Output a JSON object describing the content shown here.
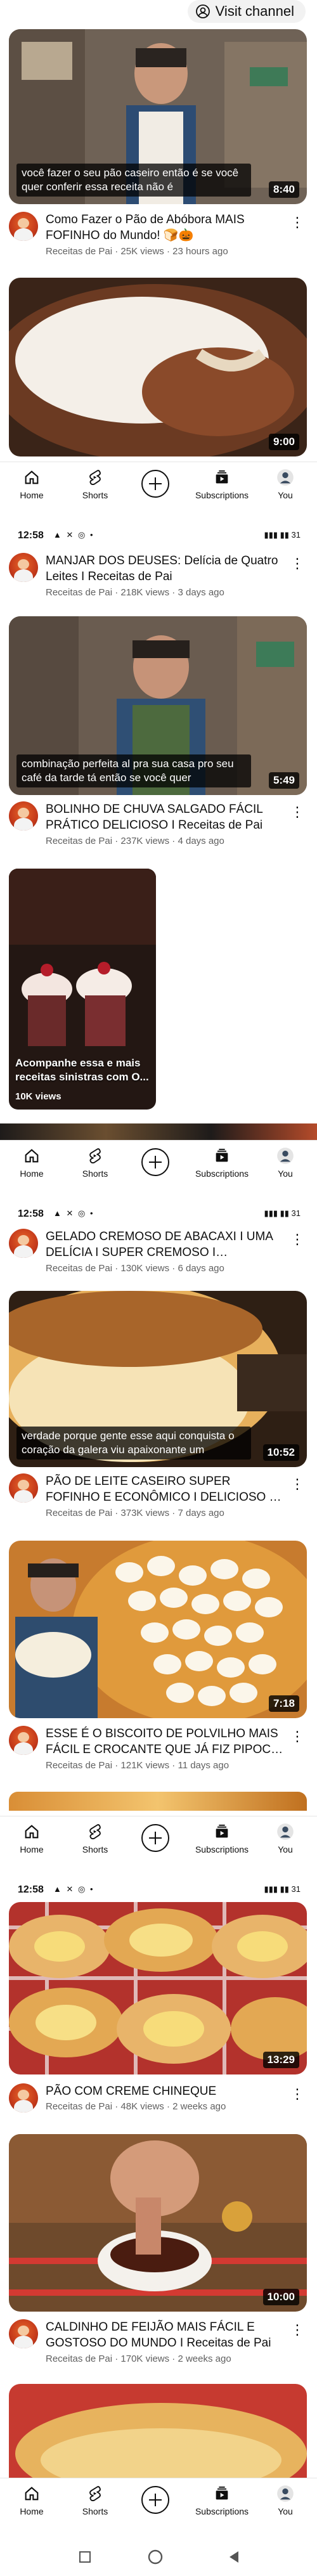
{
  "header": {
    "visit_channel_label": "Visit channel"
  },
  "status_bar": {
    "time": "12:58",
    "left_icons": "▲ ✕ ◎ •",
    "right_icons": "▮▮▮ ▮▮ 31"
  },
  "nav": {
    "home": "Home",
    "shorts": "Shorts",
    "subscriptions": "Subscriptions",
    "you": "You"
  },
  "videos": [
    {
      "caption": "você fazer o seu pão caseiro então é se você quer conferir essa receita não é",
      "duration": "8:40",
      "title": "Como Fazer o Pão de Abóbora MAIS FOFINHO do Mundo! 🍞🎃",
      "channel": "Receitas de Pai",
      "views": "25K views",
      "age": "23 hours ago"
    },
    {
      "caption": "",
      "duration": "9:00",
      "title": "MANJAR DOS DEUSES: Delícia de Quatro Leites I Receitas de Pai",
      "channel": "Receitas de Pai",
      "views": "218K views",
      "age": "3 days ago"
    },
    {
      "caption": "combinação perfeita al pra sua casa pro seu café da tarde tá então se você quer",
      "duration": "5:49",
      "title": "BOLINHO DE CHUVA SALGADO FÁCIL PRÁTICO DELICIOSO I Receitas de Pai",
      "channel": "Receitas de Pai",
      "views": "237K views",
      "age": "4 days ago"
    },
    {
      "caption": "",
      "duration": "",
      "title": "GELADO CREMOSO DE ABACAXI I UMA DELÍCIA I SUPER CREMOSO I SOBREMESA ...",
      "channel": "Receitas de Pai",
      "views": "130K views",
      "age": "6 days ago"
    },
    {
      "caption": "verdade porque gente esse aqui conquista o coração da galera viu apaixonante um",
      "duration": "10:52",
      "title": "PÃO DE LEITE CASEIRO SUPER FOFINHO E ECONÔMICO I DELICIOSO I FÁCIL I Receita...",
      "channel": "Receitas de Pai",
      "views": "373K views",
      "age": "7 days ago"
    },
    {
      "caption": "",
      "duration": "7:18",
      "title": "ESSE É O BISCOITO DE POLVILHO MAIS FÁCIL E CROCANTE QUE JÁ FIZ PIPOCA DE...",
      "channel": "Receitas de Pai",
      "views": "121K views",
      "age": "11 days ago"
    },
    {
      "caption": "",
      "duration": "13:29",
      "title": "PÃO COM CREME CHINEQUE",
      "channel": "Receitas de Pai",
      "views": "48K views",
      "age": "2 weeks ago"
    },
    {
      "caption": "",
      "duration": "10:00",
      "title": "CALDINHO DE FEIJÃO MAIS FÁCIL E GOSTOSO DO MUNDO I Receitas de Pai",
      "channel": "Receitas de Pai",
      "views": "170K views",
      "age": "2 weeks ago"
    }
  ],
  "short": {
    "caption": "Acompanhe essa e mais receitas sinistras com O...",
    "views": "10K views"
  },
  "separator": "·"
}
